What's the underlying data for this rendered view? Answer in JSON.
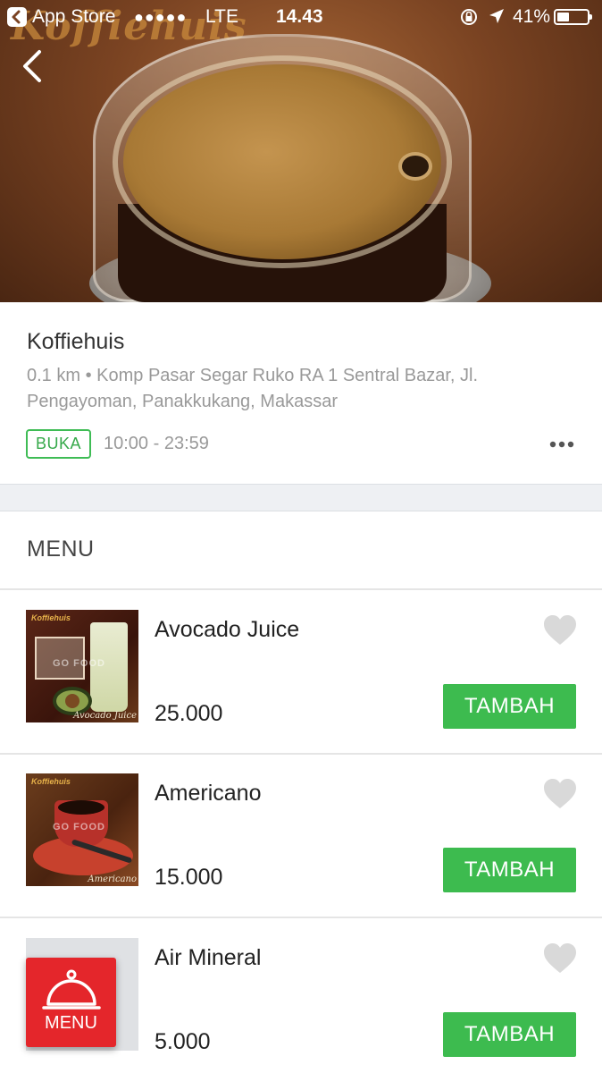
{
  "status_bar": {
    "back_app": "App Store",
    "signal": "●●●●●",
    "network": "LTE",
    "time": "14.43",
    "battery": "41%",
    "battery_level": 0.41
  },
  "hero": {
    "logo_text": "Koffiehuis",
    "back_icon": "chevron-left-icon"
  },
  "restaurant": {
    "name": "Koffiehuis",
    "address": "0.1 km • Komp Pasar Segar Ruko RA 1 Sentral Bazar, Jl. Pengayoman, Panakkukang, Makassar",
    "status": "BUKA",
    "hours": "10:00 - 23:59",
    "more_icon": "more-horizontal-icon"
  },
  "menu": {
    "section_title": "MENU",
    "add_label": "TAMBAH",
    "items": [
      {
        "name": "Avocado Juice",
        "price": "25.000",
        "thumb_logo": "Koffiehuis",
        "thumb_watermark": "GO FOOD",
        "thumb_caption": "Avocado Juice"
      },
      {
        "name": "Americano",
        "price": "15.000",
        "thumb_logo": "Koffiehuis",
        "thumb_watermark": "GO FOOD",
        "thumb_caption": "Americano"
      },
      {
        "name": "Air Mineral",
        "price": "5.000"
      }
    ]
  },
  "fab": {
    "label": "MENU",
    "icon": "cloche-icon",
    "color": "#e4262b"
  },
  "colors": {
    "accent_green": "#3dbb4f",
    "badge_green": "#36a94a",
    "secondary_text": "#999999"
  }
}
